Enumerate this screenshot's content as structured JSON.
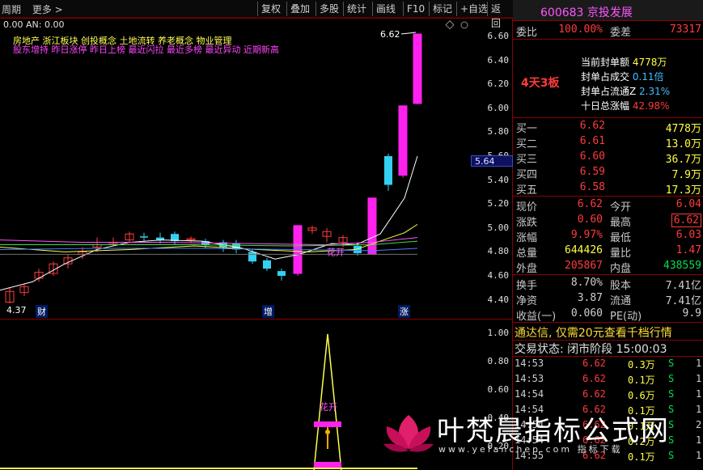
{
  "toolbar": {
    "period": "周期",
    "more": "更多 >",
    "buttons": [
      "复权",
      "叠加",
      "多股",
      "统计",
      "画线",
      "F10",
      "标记",
      "+自选",
      "返回"
    ]
  },
  "chart": {
    "ma_text": "0.00  AN: 0.00",
    "concepts": "房地产    浙江板块  创投概念 土地流转 养老概念 物业管理",
    "tags": "股东增持 昨日涨停 昨日上榜 最近闪拉 最近多榜 最近异动 近期新高",
    "price_labels": [
      "6.60",
      "6.40",
      "6.20",
      "6.00",
      "5.80",
      "5.60",
      "5.40",
      "5.20",
      "5.00",
      "4.80",
      "4.60",
      "4.40"
    ],
    "current_price_tag": "5.64",
    "high_label": "6.62",
    "low_label": "4.37",
    "markers": [
      "财",
      "增",
      "涨"
    ],
    "huakai": "花开"
  },
  "indicator": {
    "axis_labels": [
      "1.00",
      "0.80",
      "0.60",
      "0.40",
      "0.20"
    ],
    "huakai": "花开"
  },
  "quote": {
    "code": "600683 京投发展",
    "weibi_label": "委比",
    "weibi_value": "100.00%",
    "weicha_label": "委差",
    "weicha_value": "73317",
    "streak": "4天3板",
    "info": [
      {
        "label": "当前封单额",
        "value": "4778万"
      },
      {
        "label": "封单占成交",
        "value": "0.11倍"
      },
      {
        "label": "封单占流通Z",
        "value": "2.31%"
      },
      {
        "label": "十日总涨幅",
        "value": "42.98%"
      }
    ],
    "bids": [
      {
        "label": "买一",
        "price": "6.62",
        "vol": "4778万"
      },
      {
        "label": "买二",
        "price": "6.61",
        "vol": "13.0万"
      },
      {
        "label": "买三",
        "price": "6.60",
        "vol": "36.7万"
      },
      {
        "label": "买四",
        "price": "6.59",
        "vol": "7.9万"
      },
      {
        "label": "买五",
        "price": "6.58",
        "vol": "17.3万"
      }
    ],
    "stats": [
      {
        "l1": "现价",
        "v1": "6.62",
        "l2": "今开",
        "v2": "6.04"
      },
      {
        "l1": "涨跌",
        "v1": "0.60",
        "l2": "最高",
        "v2": "6.62"
      },
      {
        "l1": "涨幅",
        "v1": "9.97%",
        "l2": "最低",
        "v2": "6.03"
      },
      {
        "l1": "总量",
        "v1": "644426",
        "l2": "量比",
        "v2": "1.47"
      },
      {
        "l1": "外盘",
        "v1": "205867",
        "l2": "内盘",
        "v2": "438559"
      }
    ],
    "fin": [
      {
        "l1": "换手",
        "v1": "8.70%",
        "l2": "股本",
        "v2": "7.41亿"
      },
      {
        "l1": "净资",
        "v1": "3.87",
        "l2": "流通",
        "v2": "7.41亿"
      },
      {
        "l1": "收益(一)",
        "v1": "0.060",
        "l2": "PE(动)",
        "v2": "9.9"
      }
    ],
    "ad": "通达信, 仅需20元查看千档行情",
    "trade_status": "交易状态: 闭市阶段 15:00:03",
    "ticks": [
      {
        "t": "14:53",
        "p": "6.62",
        "v": "0.3万",
        "d": "S",
        "n": "1"
      },
      {
        "t": "14:53",
        "p": "6.62",
        "v": "0.1万",
        "d": "S",
        "n": "1"
      },
      {
        "t": "14:54",
        "p": "6.62",
        "v": "0.6万",
        "d": "S",
        "n": "1"
      },
      {
        "t": "14:54",
        "p": "6.62",
        "v": "0.1万",
        "d": "S",
        "n": "1"
      },
      {
        "t": "14:54",
        "p": "6.62",
        "v": "0.1万",
        "d": "S",
        "n": "2"
      },
      {
        "t": "14:54",
        "p": "6.62",
        "v": "0.2万",
        "d": "S",
        "n": "1"
      },
      {
        "t": "14:55",
        "p": "6.62",
        "v": "0.1万",
        "d": "S",
        "n": "1"
      }
    ]
  },
  "watermark": {
    "text": "叶梵晨指标公式网",
    "sub": "www.yefanchen.com 指标下载"
  }
}
